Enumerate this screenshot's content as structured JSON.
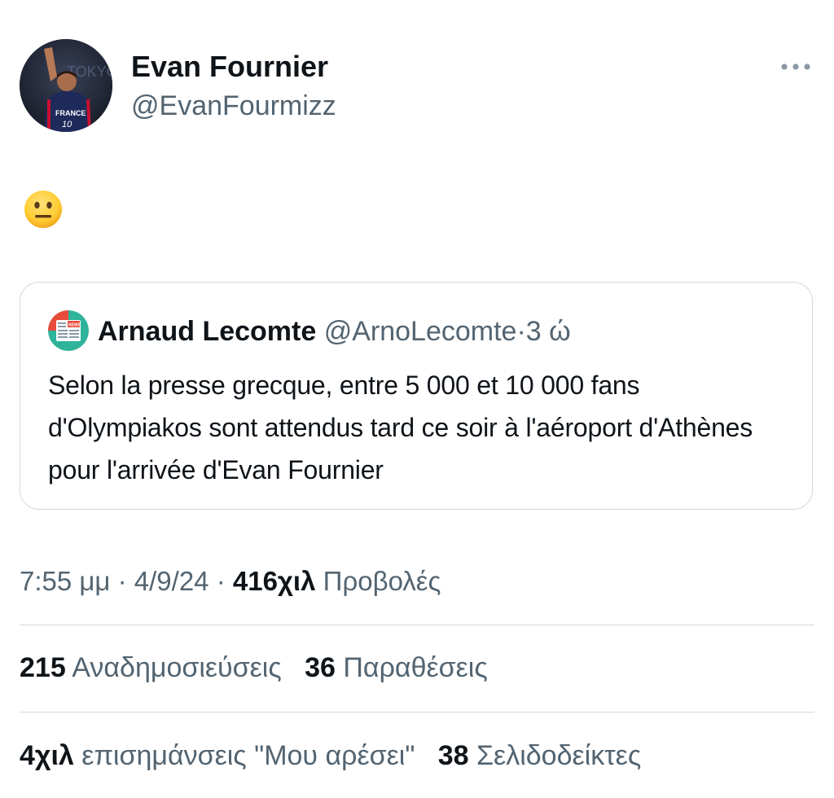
{
  "author": {
    "name": "Evan Fournier",
    "handle": "@EvanFourmizz",
    "avatar_jersey_text": "FRANCE",
    "avatar_jersey_number": "10",
    "avatar_background_text": "TOKYO 2020"
  },
  "icons": {
    "more": "more-horizontal-icon",
    "emoji": "neutral-face-emoji",
    "quote_avatar": "newspaper-icon"
  },
  "tweet": {
    "text_emoji": "neutral-face"
  },
  "quote": {
    "name": "Arnaud Lecomte",
    "handle": "@ArnoLecomte",
    "separator": "·",
    "time": "3 ώ",
    "avatar_badge": "NEWS",
    "text": "Selon la presse grecque, entre 5 000 et 10 000 fans d'Olympiakos sont attendus tard ce soir à l'aéroport d'Athènes pour l'arrivée d'Evan Fournier"
  },
  "meta": {
    "time": "7:55 μμ",
    "separator": "·",
    "date": "4/9/24",
    "views_count": "416χιλ",
    "views_label": "Προβολές"
  },
  "stats": {
    "reposts_count": "215",
    "reposts_label": "Αναδημοσιεύσεις",
    "quotes_count": "36",
    "quotes_label": "Παραθέσεις",
    "likes_count": "4χιλ",
    "likes_label": "επισημάνσεις \"Μου αρέσει\"",
    "bookmarks_count": "38",
    "bookmarks_label": "Σελιδοδείκτες"
  },
  "colors": {
    "text_primary": "#0f1419",
    "text_secondary": "#536471",
    "border": "#cfd9de",
    "background": "#ffffff",
    "jersey_blue": "#1e2a5a",
    "emoji_yellow": "#ffcc33"
  }
}
